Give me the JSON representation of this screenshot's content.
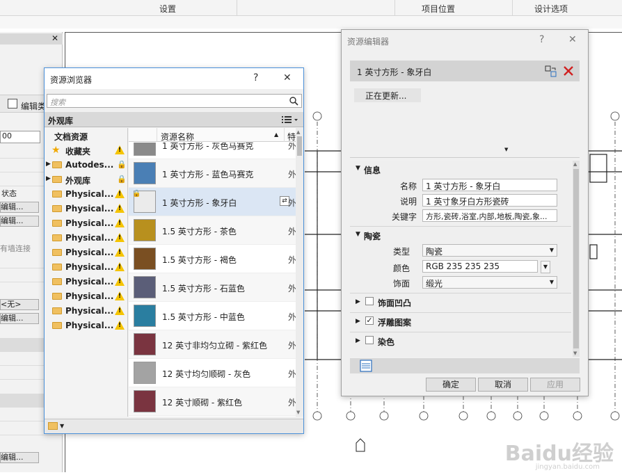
{
  "ribbon": {
    "labels": [
      "设置",
      "项目位置",
      "设计选项"
    ]
  },
  "props": {
    "close_glyph": "✕",
    "edit_type_label": "编辑类",
    "value_field": "00",
    "state_label": "状态",
    "edit_btn_1": "编辑...",
    "edit_btn_2": "编辑...",
    "wall_note": "有墙连接",
    "none_value": "<无>",
    "edit_btn_3": "编辑...",
    "edit_btn_4": "编辑..."
  },
  "browser": {
    "title": "资源浏览器",
    "help": "?",
    "close": "✕",
    "search_placeholder": "搜索",
    "library_label": "外观库",
    "tree": {
      "header": "文档资源",
      "items": [
        {
          "label": "收藏夹",
          "kind": "star",
          "badge": "warn"
        },
        {
          "label": "Autodes...",
          "kind": "folder",
          "badge": "lock"
        },
        {
          "label": "外观库",
          "kind": "folder",
          "badge": "lock"
        },
        {
          "label": "Physical...",
          "kind": "folder",
          "badge": "warn"
        },
        {
          "label": "Physical...",
          "kind": "folder",
          "badge": "warn"
        },
        {
          "label": "Physical...",
          "kind": "folder",
          "badge": "warn"
        },
        {
          "label": "Physical...",
          "kind": "folder",
          "badge": "warn"
        },
        {
          "label": "Physical...",
          "kind": "folder",
          "badge": "warn"
        },
        {
          "label": "Physical...",
          "kind": "folder",
          "badge": "warn"
        },
        {
          "label": "Physical...",
          "kind": "folder",
          "badge": "warn"
        },
        {
          "label": "Physical...",
          "kind": "folder",
          "badge": "warn"
        },
        {
          "label": "Physical...",
          "kind": "folder",
          "badge": "warn"
        },
        {
          "label": "Physical...",
          "kind": "folder",
          "badge": "warn"
        }
      ]
    },
    "columns": {
      "name": "资源名称",
      "type": "特"
    },
    "rows": [
      {
        "name": "1 英寸方形 - 灰色马赛克",
        "type": "外",
        "color": "#8a8a8a"
      },
      {
        "name": "1 英寸方形 - 蓝色马赛克",
        "type": "外",
        "color": "#4a7fb5"
      },
      {
        "name": "1 英寸方形 - 象牙白",
        "type": "外",
        "color": "#ebebeb",
        "selected": true
      },
      {
        "name": "1.5 英寸方形 - 茶色",
        "type": "外",
        "color": "#b8901e"
      },
      {
        "name": "1.5 英寸方形 - 褐色",
        "type": "外",
        "color": "#7a4f22"
      },
      {
        "name": "1.5 英寸方形 - 石蓝色",
        "type": "外",
        "color": "#5b5e78"
      },
      {
        "name": "1.5 英寸方形 - 中蓝色",
        "type": "外",
        "color": "#2a7ea0"
      },
      {
        "name": "12 英寸非均匀立砌 - 紫红色",
        "type": "外",
        "color": "#7a3440"
      },
      {
        "name": "12 英寸均匀顺砌 - 灰色",
        "type": "外",
        "color": "#a3a3a3"
      },
      {
        "name": "12 英寸顺砌 - 紫红色",
        "type": "外",
        "color": "#7a3440"
      }
    ]
  },
  "editor": {
    "title": "资源编辑器",
    "help": "?",
    "close": "✕",
    "asset_name": "1 英寸方形 - 象牙白",
    "updating": "正在更新...",
    "info_section": "信息",
    "name_label": "名称",
    "name_value": "1 英寸方形 - 象牙白",
    "desc_label": "说明",
    "desc_value": "1 英寸象牙白方形瓷砖",
    "keywords_label": "关键字",
    "keywords_value": "方形,瓷砖,浴室,内部,地板,陶瓷,象...",
    "ceramic_section": "陶瓷",
    "type_label": "类型",
    "type_value": "陶瓷",
    "color_label": "颜色",
    "color_value": "RGB 235 235 235",
    "finish_label": "饰面",
    "finish_value": "缎光",
    "bump_label": "饰面凹凸",
    "relief_label": "浮雕图案",
    "tint_label": "染色",
    "ok": "确定",
    "cancel": "取消",
    "apply": "应用"
  },
  "watermark": {
    "main": "Baidu经验",
    "sub": "jingyan.baidu.com"
  }
}
